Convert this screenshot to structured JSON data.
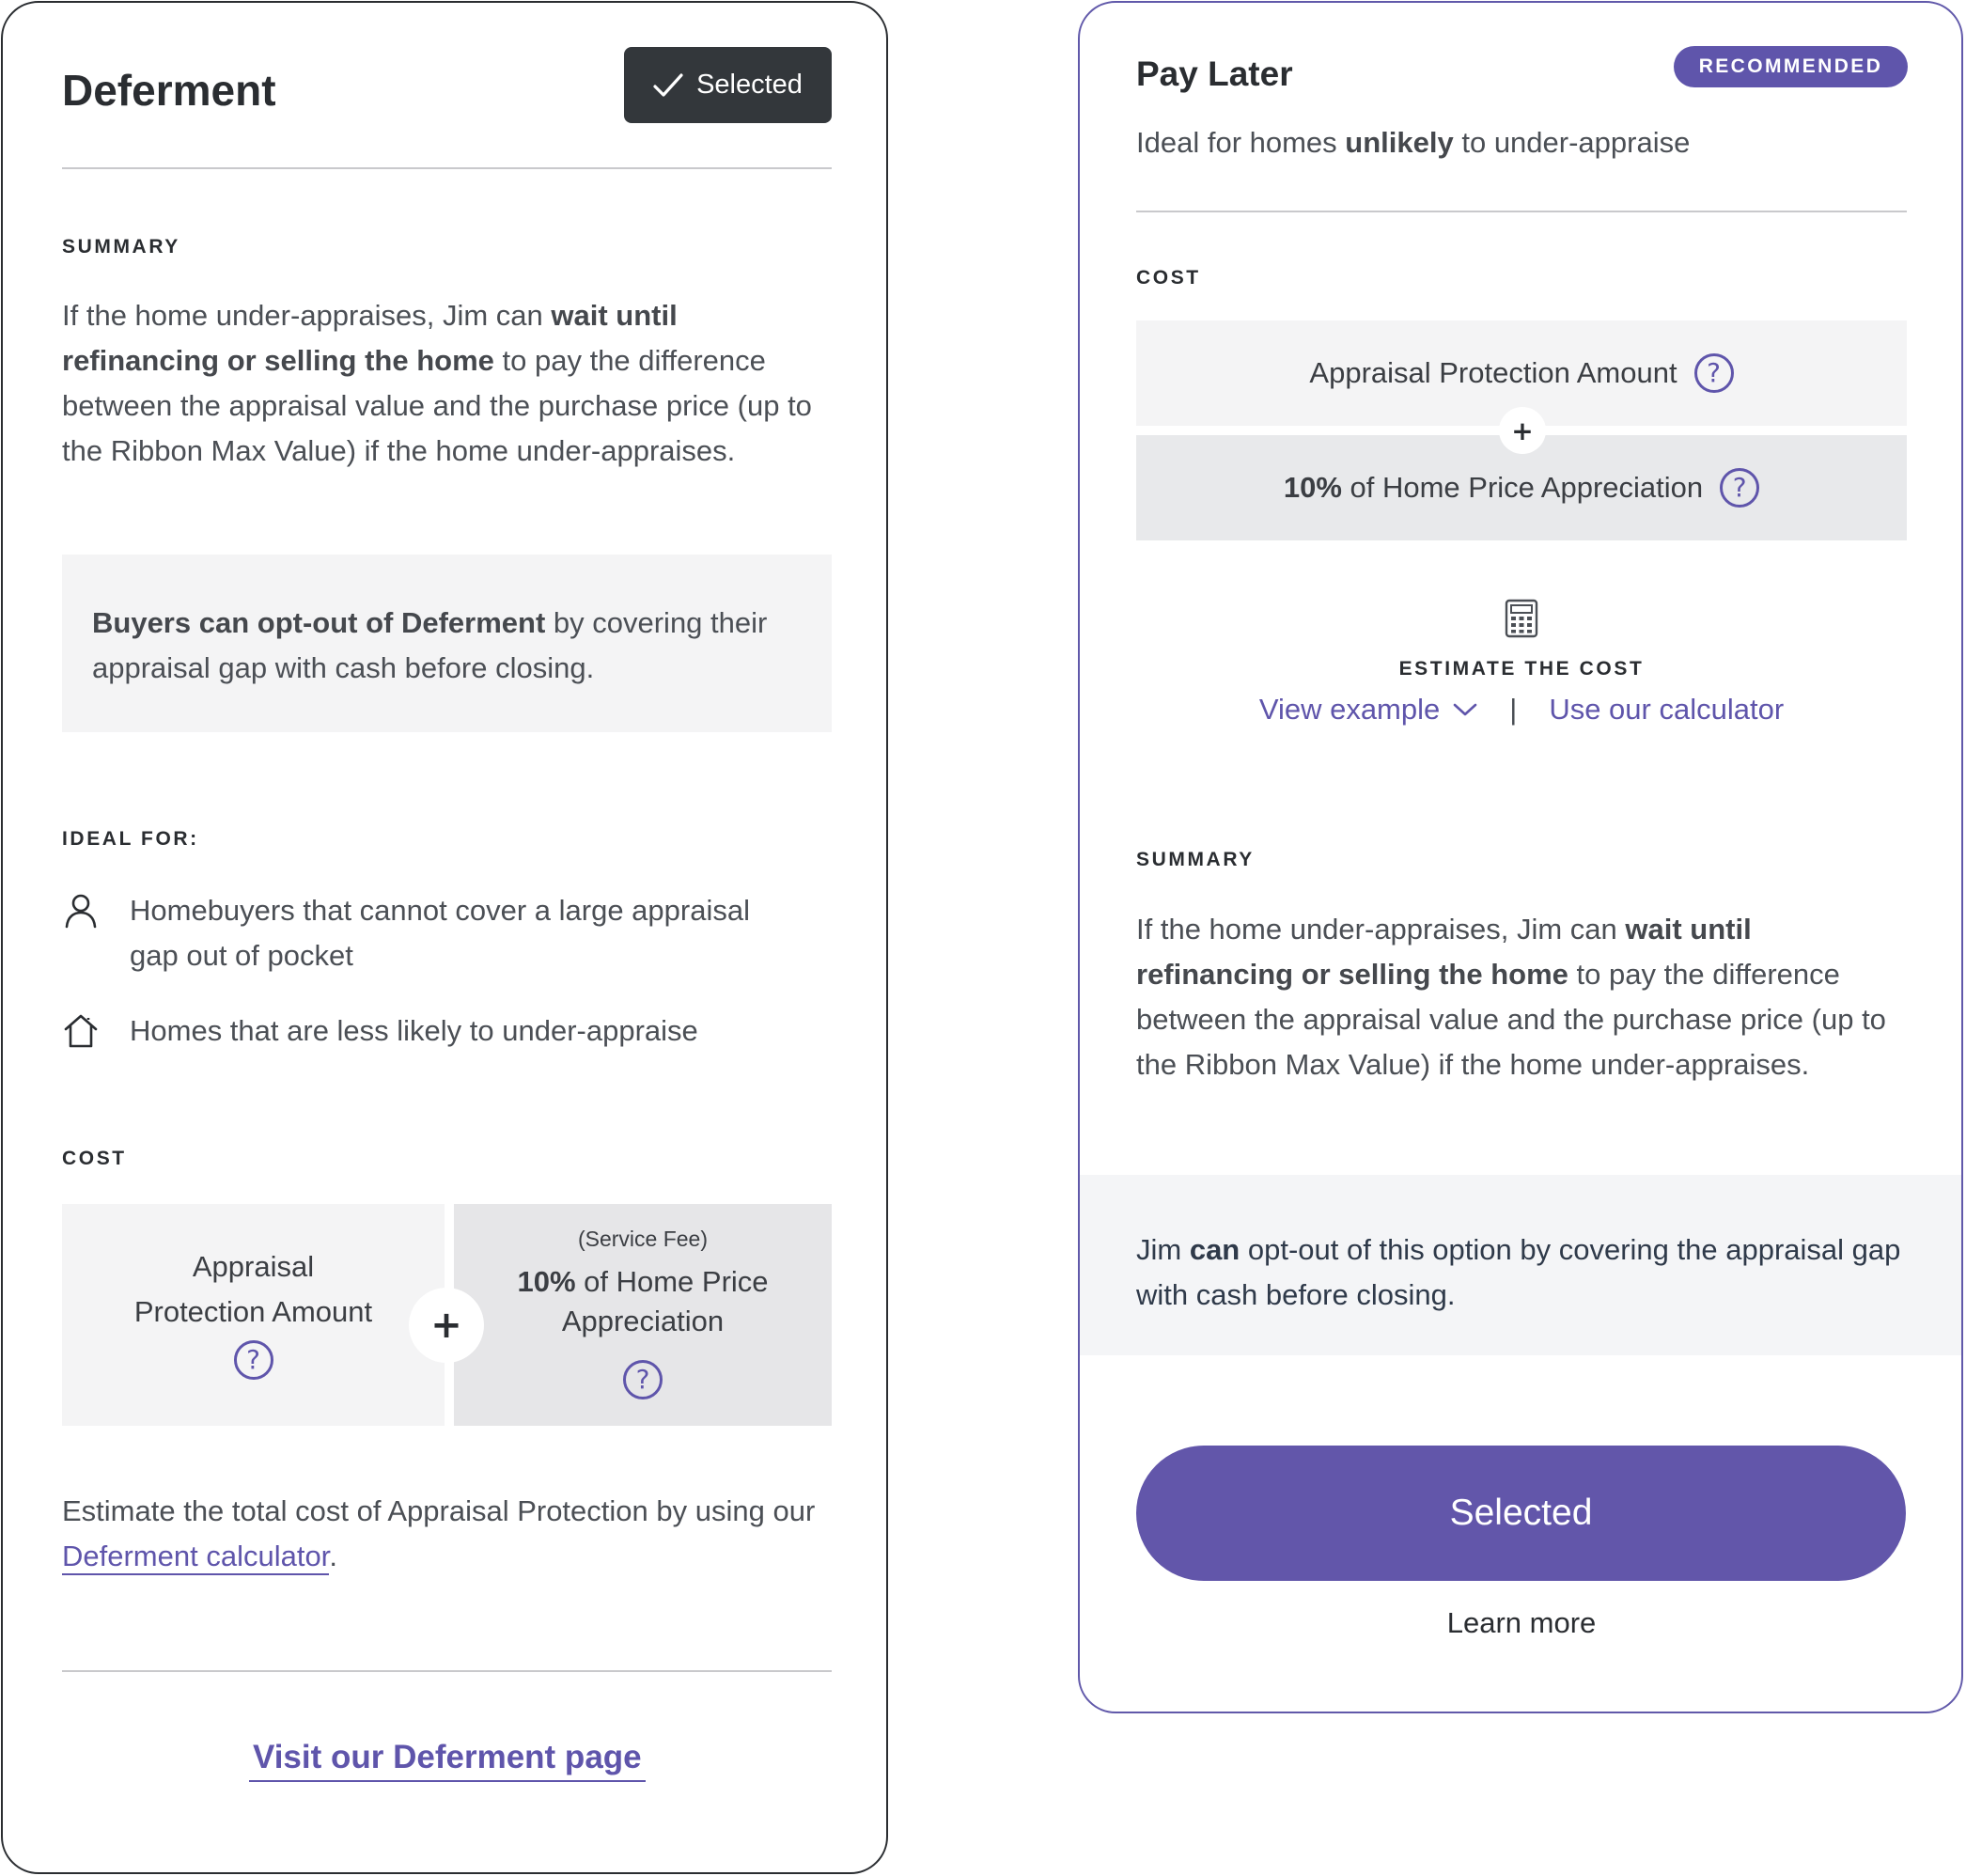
{
  "left_card": {
    "title": "Deferment",
    "selected_label": "Selected",
    "summary_label": "SUMMARY",
    "summary": {
      "part1": "If the home under-appraises, Jim can ",
      "bold": "wait until refinancing or selling the home",
      "part2": " to pay the difference between the appraisal value and the purchase price (up to the Ribbon Max Value) if the home under-appraises."
    },
    "optout": {
      "bold": "Buyers can opt-out of Deferment",
      "rest": " by covering their appraisal gap with cash before closing."
    },
    "ideal_label": "IDEAL FOR:",
    "ideal_items": [
      {
        "icon": "person-icon",
        "text": "Homebuyers that cannot cover a large appraisal gap out of pocket"
      },
      {
        "icon": "home-icon",
        "text": "Homes that are less likely to under-appraise"
      }
    ],
    "cost_label": "COST",
    "cost_a": {
      "line1": "Appraisal",
      "line2": "Protection Amount"
    },
    "cost_b": {
      "note": "(Service Fee)",
      "bold": "10%",
      "line1_rest": " of Home Price",
      "line2": "Appreciation"
    },
    "plus": "+",
    "estimate": {
      "prefix": "Estimate the total cost of Appraisal Protection by using our ",
      "link": "Deferment calculator",
      "suffix": "."
    },
    "visit_link": "Visit our Deferment page"
  },
  "right_card": {
    "title": "Pay Later",
    "badge": "RECOMMENDED",
    "subtitle": {
      "prefix": "Ideal for homes ",
      "bold": "unlikely",
      "suffix": " to under-appraise"
    },
    "cost_label": "COST",
    "cost_row_1": "Appraisal Protection Amount",
    "cost_row_2": {
      "bold": "10%",
      "rest": " of Home Price Appreciation"
    },
    "plus": "+",
    "estimate_label": "ESTIMATE THE COST",
    "view_example": "View example",
    "separator": "|",
    "use_calculator": "Use our calculator",
    "summary_label": "SUMMARY",
    "summary": {
      "part1": "If the home under-appraises, Jim can ",
      "bold": "wait until refinancing or selling the home",
      "part2": " to pay the difference between the appraisal value and the purchase price (up to the Ribbon Max Value) if the home under-appraises."
    },
    "optout": {
      "prefix": "Jim ",
      "bold": "can",
      "rest": " opt-out of this option by covering the appraisal gap with cash before closing."
    },
    "selected_button": "Selected",
    "learn_more": "Learn more"
  },
  "colors": {
    "accent": "#5f55ab",
    "dark_button": "#33373b",
    "muted_box": "#f4f4f5"
  }
}
